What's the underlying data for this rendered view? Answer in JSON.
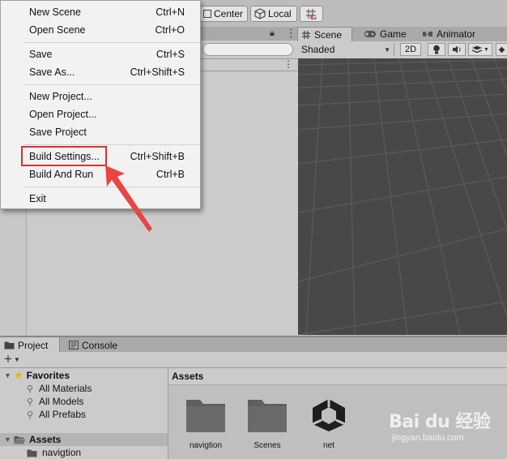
{
  "toolbar": {
    "center_label": "Center",
    "local_label": "Local"
  },
  "file_menu": {
    "items": [
      {
        "label": "New Scene",
        "shortcut": "Ctrl+N"
      },
      {
        "label": "Open Scene",
        "shortcut": "Ctrl+O"
      },
      {
        "label": "Save",
        "shortcut": "Ctrl+S"
      },
      {
        "label": "Save As...",
        "shortcut": "Ctrl+Shift+S"
      },
      {
        "label": "New Project...",
        "shortcut": ""
      },
      {
        "label": "Open Project...",
        "shortcut": ""
      },
      {
        "label": "Save Project",
        "shortcut": ""
      },
      {
        "label": "Build Settings...",
        "shortcut": "Ctrl+Shift+B"
      },
      {
        "label": "Build And Run",
        "shortcut": "Ctrl+B"
      },
      {
        "label": "Exit",
        "shortcut": ""
      }
    ],
    "highlight_color": "#e03030"
  },
  "scene_view": {
    "tabs": [
      {
        "label": "Scene",
        "icon": "hash-icon"
      },
      {
        "label": "Game",
        "icon": "gamepad-icon"
      },
      {
        "label": "Animator",
        "icon": "animator-icon"
      }
    ],
    "draw_mode": "Shaded",
    "mode_2d": "2D",
    "background_color": "#484848"
  },
  "project_panel": {
    "tabs": [
      {
        "label": "Project",
        "icon": "folder-icon"
      },
      {
        "label": "Console",
        "icon": "console-icon"
      }
    ],
    "favorites_label": "Favorites",
    "favorites": [
      "All Materials",
      "All Models",
      "All Prefabs"
    ],
    "assets_label": "Assets",
    "assets_children": [
      "navigtion"
    ],
    "breadcrumb": "Assets",
    "items": [
      {
        "label": "navigtion",
        "icon": "folder-icon"
      },
      {
        "label": "Scenes",
        "icon": "folder-icon"
      },
      {
        "label": "net",
        "icon": "unity-logo-icon"
      }
    ]
  },
  "watermark": {
    "brand": "Bai du 经验",
    "url": "jingyan.baidu.com"
  }
}
